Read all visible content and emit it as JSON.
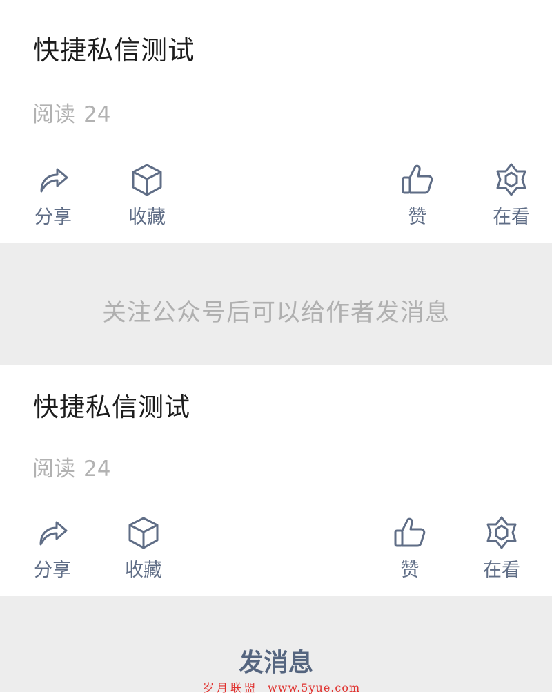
{
  "article_top": {
    "title": "快捷私信测试",
    "reads_label": "阅读",
    "reads_count": "24",
    "actions": {
      "share": "分享",
      "favorite": "收藏",
      "like": "赞",
      "wow": "在看"
    }
  },
  "follow_notice": {
    "text": "关注公众号后可以给作者发消息"
  },
  "article_bottom": {
    "title": "快捷私信测试",
    "reads_label": "阅读",
    "reads_count": "24",
    "actions": {
      "share": "分享",
      "favorite": "收藏",
      "like": "赞",
      "wow": "在看"
    }
  },
  "message_bar": {
    "send_label": "发消息"
  },
  "watermark": {
    "site": "岁月联盟",
    "url": "www.5yue.com"
  },
  "colors": {
    "icon": "#5f6d86",
    "title": "#1c1c1c",
    "muted": "#b2b2b2",
    "band": "#ededed",
    "watermark": "#e0322f"
  }
}
